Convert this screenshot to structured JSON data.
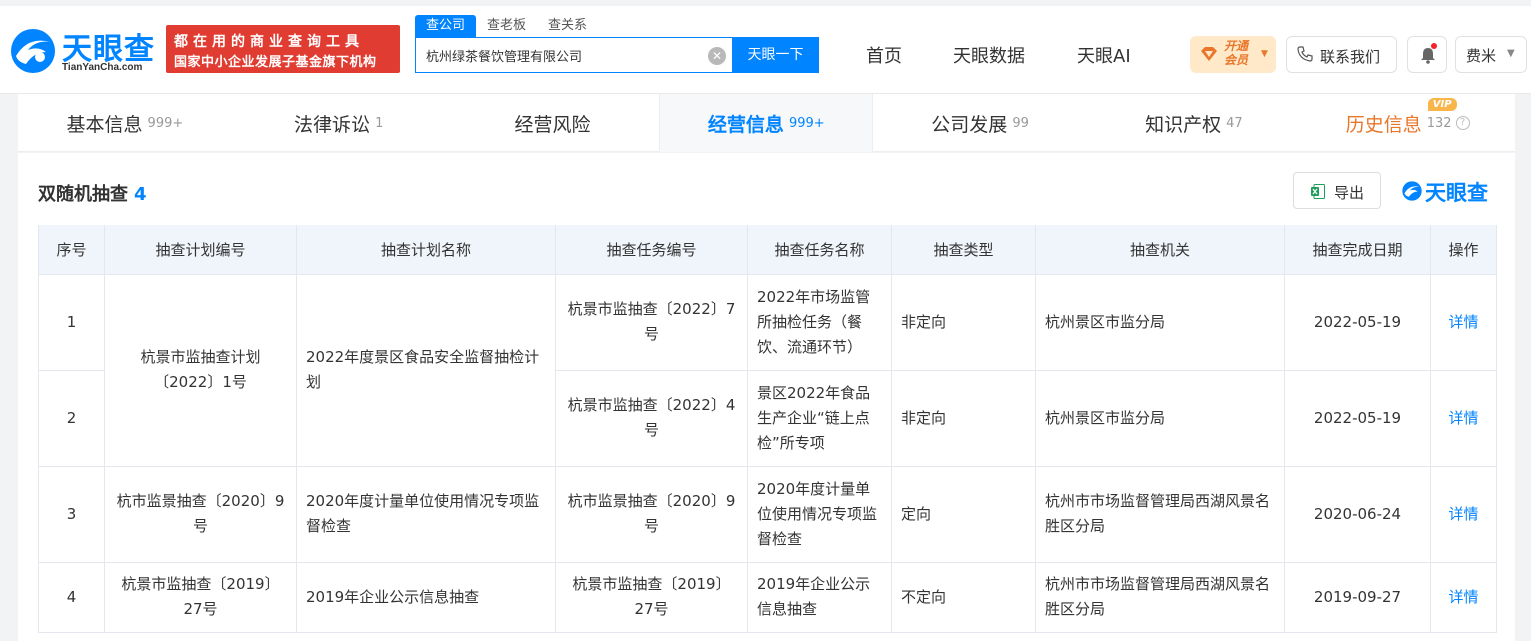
{
  "brand": {
    "logo_text": "天眼查",
    "logo_sub": "TianYanCha.com",
    "slogan_line1": "都在用的商业查询工具",
    "slogan_line2": "国家中小企业发展子基金旗下机构"
  },
  "search": {
    "tabs": [
      "查公司",
      "查老板",
      "查关系"
    ],
    "value": "杭州绿茶餐饮管理有限公司",
    "button": "天眼一下"
  },
  "nav": {
    "items": [
      "首页",
      "天眼数据",
      "天眼AI"
    ],
    "vip_line1": "开通",
    "vip_line2": "会员",
    "contact": "联系我们",
    "user": "费米"
  },
  "tabs": [
    {
      "label": "基本信息",
      "count": "999+"
    },
    {
      "label": "法律诉讼",
      "count": "1"
    },
    {
      "label": "经营风险",
      "count": ""
    },
    {
      "label": "经营信息",
      "count": "999+"
    },
    {
      "label": "公司发展",
      "count": "99"
    },
    {
      "label": "知识产权",
      "count": "47"
    },
    {
      "label": "历史信息",
      "count": "132",
      "badge": "VIP"
    }
  ],
  "section": {
    "title": "双随机抽查",
    "count": "4",
    "export": "导出",
    "watermark": "天眼查"
  },
  "table": {
    "headers": [
      "序号",
      "抽查计划编号",
      "抽查计划名称",
      "抽查任务编号",
      "抽查任务名称",
      "抽查类型",
      "抽查机关",
      "抽查完成日期",
      "操作"
    ],
    "plans": [
      {
        "code": "杭景市监抽查计划〔2022〕1号",
        "name": "2022年度景区食品安全监督抽检计划"
      },
      {
        "code": "杭市监景抽查〔2020〕9号",
        "name": "2020年度计量单位使用情况专项监督检查"
      },
      {
        "code": "杭景市监抽查〔2019〕27号",
        "name": "2019年企业公示信息抽查"
      }
    ],
    "rows": [
      {
        "no": "1",
        "task_code": "杭景市监抽查〔2022〕7号",
        "task_name": "2022年市场监管所抽检任务（餐饮、流通环节）",
        "type": "非定向",
        "org": "杭州景区市监分局",
        "date": "2022-05-19",
        "action": "详情"
      },
      {
        "no": "2",
        "task_code": "杭景市监抽查〔2022〕4号",
        "task_name": "景区2022年食品生产企业“链上点检”所专项",
        "type": "非定向",
        "org": "杭州景区市监分局",
        "date": "2022-05-19",
        "action": "详情"
      },
      {
        "no": "3",
        "task_code": "杭市监景抽查〔2020〕9号",
        "task_name": "2020年度计量单位使用情况专项监督检查",
        "type": "定向",
        "org": "杭州市市场监督管理局西湖风景名胜区分局",
        "date": "2020-06-24",
        "action": "详情"
      },
      {
        "no": "4",
        "task_code": "杭景市监抽查〔2019〕27号",
        "task_name": "2019年企业公示信息抽查",
        "type": "不定向",
        "org": "杭州市市场监督管理局西湖风景名胜区分局",
        "date": "2019-09-27",
        "action": "详情"
      }
    ]
  }
}
